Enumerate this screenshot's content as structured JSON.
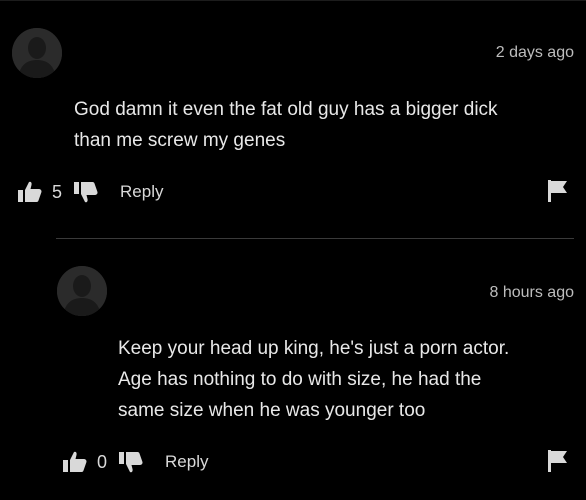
{
  "comments": [
    {
      "time": "2 days ago",
      "text_lines": [
        "God damn it even the fat old guy has a bigger dick",
        "than me screw my genes"
      ],
      "likes": "5",
      "reply_label": "Reply"
    },
    {
      "time": "8 hours ago",
      "text_lines": [
        "Keep your head up king, he's just a porn actor.",
        "Age has nothing to do with size, he had the",
        "same size when he was younger too"
      ],
      "likes": "0",
      "reply_label": "Reply"
    }
  ],
  "icons": {
    "avatar": "user-avatar-icon",
    "like": "thumbs-up-icon",
    "dislike": "thumbs-down-icon",
    "flag": "flag-icon"
  },
  "colors": {
    "background": "#000000",
    "text": "#e8e8e8",
    "muted": "#bdbdbd",
    "avatar": "#2b2b2b"
  }
}
